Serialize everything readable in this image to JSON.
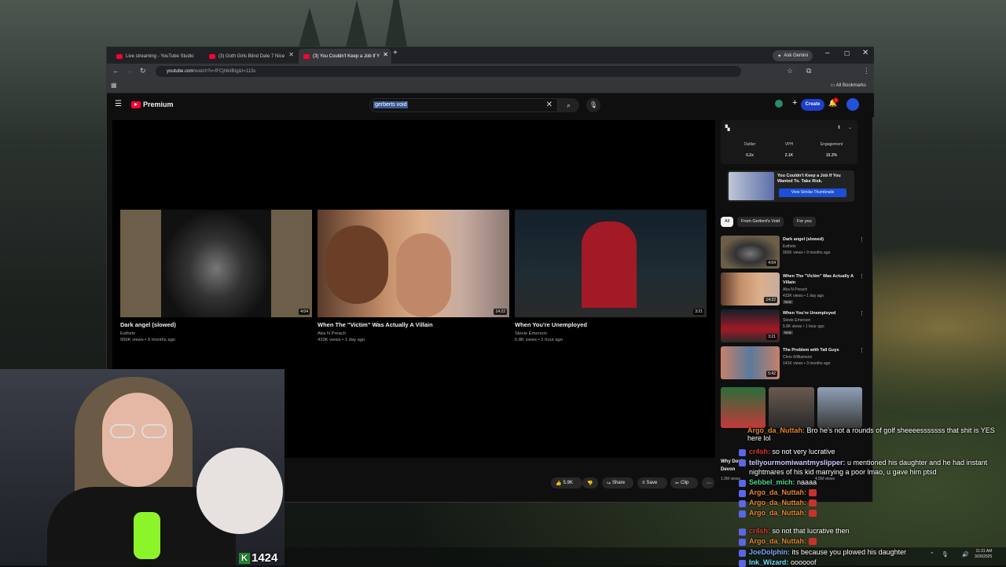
{
  "browser": {
    "tabs": [
      {
        "label": "Live streaming - YouTube Studio"
      },
      {
        "label": "(3) Goth Girls Blind Date 7 Nice"
      },
      {
        "label": "(3) You Couldn't Keep a Job If Y"
      }
    ],
    "ask_gemini": "Ask Gemini",
    "url_host": "youtube.com",
    "url_path": "/watch?v=fFCjh6dBtg&t=113s",
    "all_bookmarks": "All Bookmarks"
  },
  "youtube": {
    "logo": "Premium",
    "search_value": "gerberts void",
    "create_label": "Create",
    "notif_count": "9"
  },
  "endscreen": [
    {
      "title": "Dark angel (slowed)",
      "channel": "Esthetx",
      "meta": "956K views • 9 months ago",
      "duration": "4:04"
    },
    {
      "title": "When The \"Victim\" Was Actually A Villain",
      "channel": "Aba N Preach",
      "meta": "433K views • 1 day ago",
      "duration": "14:22"
    },
    {
      "title": "When You're Unemployed",
      "channel": "Stevie Emerson",
      "meta": "5.8K views • 1 hour ago",
      "duration": "3:21"
    }
  ],
  "actions": {
    "likes": "5.9K",
    "share": "Share",
    "save": "Save",
    "clip": "Clip"
  },
  "extension": {
    "stats": [
      {
        "label": "Outlier",
        "value": "0.2x"
      },
      {
        "label": "VPH",
        "value": "2.1K"
      },
      {
        "label": "Engagement",
        "value": "15.3%"
      }
    ],
    "similar_title": "You Couldn't Keep a Job If You Wanted To. Take Risk.",
    "similar_button": "View Similar Thumbnails"
  },
  "chips": [
    "All",
    "From Gerbert's Void",
    "For you"
  ],
  "recommended": [
    {
      "title": "Dark angel (slowed)",
      "channel": "Esthetx",
      "meta": "956K views • 9 months ago",
      "duration": "4:04",
      "is_new": false
    },
    {
      "title": "When The \"Victim\" Was Actually A Villain",
      "channel": "Aba N Preach",
      "meta": "433K views • 1 day ago",
      "duration": "14:22",
      "is_new": true
    },
    {
      "title": "When You're Unemployed",
      "channel": "Stevie Emerson",
      "meta": "5.8K views • 1 hour ago",
      "duration": "3:21",
      "is_new": true
    },
    {
      "title": "The Problem with Tall Guys",
      "channel": "Chris Williamson",
      "meta": "141K views • 3 months ago",
      "duration": "5:42",
      "is_new": false
    }
  ],
  "new_badge": "New",
  "shorts_partial": {
    "title": "Why Don't",
    "channel": "Devon",
    "views": "1.9M views",
    "views2": "4.5M views"
  },
  "chat": [
    {
      "user": "Argo_da_Nuttah:",
      "text": "Bro he's not a rounds of golf sheeeesssssss that shit is YES here lol",
      "user_color": "#e0862e"
    },
    {
      "user": "cr4sh:",
      "text": "so not very lucrative",
      "user_color": "#e0372b"
    },
    {
      "user": "tellyourmomiwantmyslipper:",
      "text": "u mentioned his daughter and he had instant nightmares of his kid marrying a poor lmao, u gave him ptsd",
      "user_color": "#c9c9ff"
    },
    {
      "user": "Sebbel_mich:",
      "text": "naaaa",
      "user_color": "#4bd88a"
    },
    {
      "user": "Argo_da_Nuttah:",
      "text": "",
      "user_color": "#e0862e"
    },
    {
      "user": "Argo_da_Nuttah:",
      "text": "",
      "user_color": "#e0862e"
    },
    {
      "user": "Argo_da_Nuttah:",
      "text": "",
      "user_color": "#e0862e"
    },
    {
      "user": "cr4sh:",
      "text": "so not that lucrative then",
      "user_color": "#e0372b"
    },
    {
      "user": "Argo_da_Nuttah:",
      "text": "",
      "user_color": "#e0862e"
    },
    {
      "user": "JoeDolphin:",
      "text": "its because you plowed his daughter",
      "user_color": "#7aa7ff"
    },
    {
      "user": "Ink_Wizard:",
      "text": "oooooof",
      "user_color": "#6ee0ff"
    }
  ],
  "viewer_count": "1424",
  "clock": {
    "time": "11:31 AM",
    "date": "3/26/2025"
  }
}
